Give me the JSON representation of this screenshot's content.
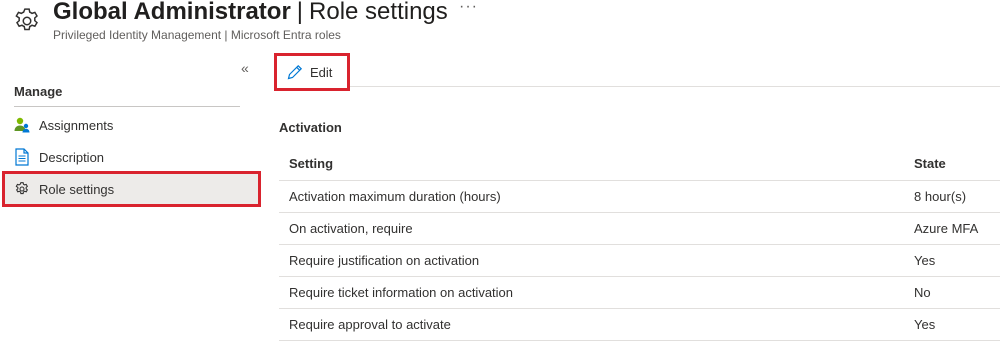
{
  "header": {
    "title_bold": "Global Administrator",
    "separator": "|",
    "title_rest": "Role settings",
    "more": "···",
    "subtitle": "Privileged Identity Management | Microsoft Entra roles"
  },
  "sidebar": {
    "collapse": "«",
    "section_label": "Manage",
    "items": [
      {
        "label": "Assignments",
        "icon": "people-icon"
      },
      {
        "label": "Description",
        "icon": "document-icon"
      },
      {
        "label": "Role settings",
        "icon": "gear-icon",
        "selected": true
      }
    ]
  },
  "toolbar": {
    "edit_label": "Edit"
  },
  "activation": {
    "title": "Activation",
    "columns": [
      "Setting",
      "State"
    ],
    "rows": [
      {
        "setting": "Activation maximum duration (hours)",
        "state": "8 hour(s)"
      },
      {
        "setting": "On activation, require",
        "state": "Azure MFA"
      },
      {
        "setting": "Require justification on activation",
        "state": "Yes"
      },
      {
        "setting": "Require ticket information on activation",
        "state": "No"
      },
      {
        "setting": "Require approval to activate",
        "state": "Yes"
      }
    ]
  },
  "colors": {
    "highlight": "#d9232e",
    "accent": "#0078d4",
    "selected_bg": "#edebe9"
  }
}
